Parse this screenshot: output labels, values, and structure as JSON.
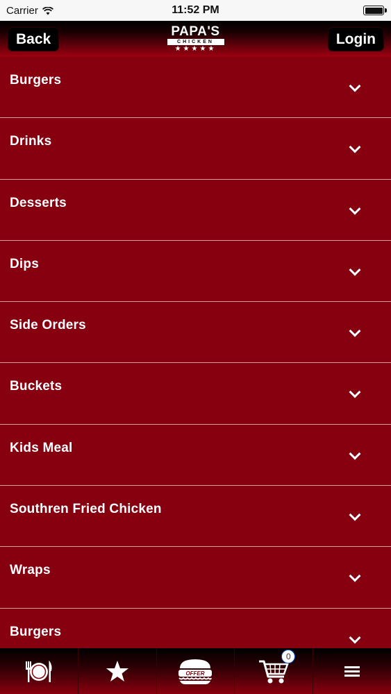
{
  "status_bar": {
    "carrier": "Carrier",
    "time": "11:52 PM"
  },
  "nav": {
    "back_label": "Back",
    "login_label": "Login",
    "logo_title": "PAPA'S",
    "logo_subtitle": "CHICKEN",
    "logo_stars": "★★★★★"
  },
  "menu": {
    "items": [
      {
        "label": "Burgers"
      },
      {
        "label": "Drinks"
      },
      {
        "label": "Desserts"
      },
      {
        "label": "Dips"
      },
      {
        "label": "Side Orders"
      },
      {
        "label": "Buckets"
      },
      {
        "label": "Kids Meal"
      },
      {
        "label": "Southren Fried Chicken"
      },
      {
        "label": "Wraps"
      },
      {
        "label": "Burgers"
      }
    ]
  },
  "tab_bar": {
    "tabs": [
      {
        "icon": "plate-cutlery-icon"
      },
      {
        "icon": "star-icon"
      },
      {
        "icon": "offer-burger-icon",
        "text": "OFFER"
      },
      {
        "icon": "cart-icon",
        "badge": "0"
      },
      {
        "icon": "menu-icon"
      }
    ]
  },
  "colors": {
    "primary_red": "#860010",
    "divider": "#d8a0a6",
    "nav_button": "#000000"
  }
}
